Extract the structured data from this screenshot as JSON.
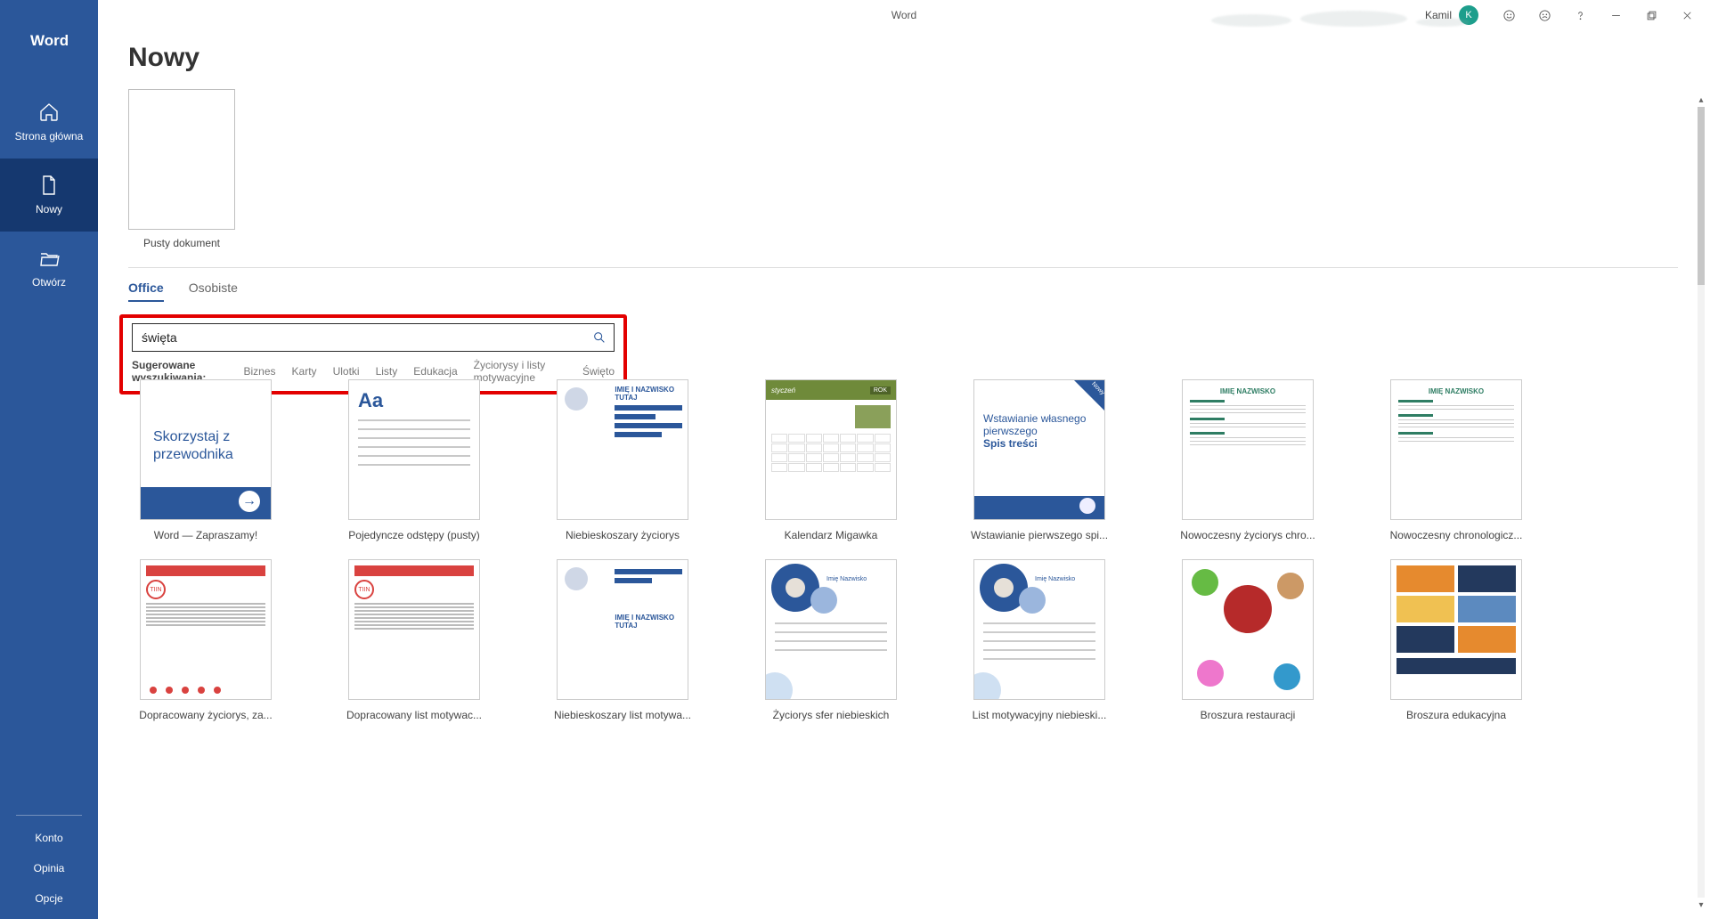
{
  "app_title": "Word",
  "brand": "Word",
  "user": {
    "name": "Kamil",
    "initial": "K"
  },
  "sidebar": {
    "items": [
      {
        "label": "Strona główna"
      },
      {
        "label": "Nowy"
      },
      {
        "label": "Otwórz"
      }
    ],
    "footer": [
      {
        "label": "Konto"
      },
      {
        "label": "Opinia"
      },
      {
        "label": "Opcje"
      }
    ]
  },
  "page_title": "Nowy",
  "blank": {
    "label": "Pusty dokument"
  },
  "tabs": [
    {
      "label": "Office",
      "active": true
    },
    {
      "label": "Osobiste",
      "active": false
    }
  ],
  "search": {
    "value": "święta",
    "suggest_label": "Sugerowane wyszukiwania:",
    "suggestions": [
      "Biznes",
      "Karty",
      "Ulotki",
      "Listy",
      "Edukacja",
      "Życiorysy i listy motywacyjne",
      "Święto"
    ]
  },
  "templates_row1": [
    {
      "label": "Word — Zapraszamy!",
      "kind": "guide",
      "text": "Skorzystaj z przewodnika"
    },
    {
      "label": "Pojedyncze odstępy (pusty)",
      "kind": "space"
    },
    {
      "label": "Niebieskoszary życiorys",
      "kind": "cvblue",
      "name_text": "IMIĘ I NAZWISKO TUTAJ"
    },
    {
      "label": "Kalendarz Migawka",
      "kind": "cal",
      "month": "styczeń",
      "year": "ROK"
    },
    {
      "label": "Wstawianie pierwszego spi...",
      "kind": "toc",
      "text": "Wstawianie własnego pierwszego",
      "strong": "Spis treści",
      "badge": "Nowy"
    },
    {
      "label": "Nowoczesny życiorys chro...",
      "kind": "mod",
      "name_text": "IMIĘ NAZWISKO"
    },
    {
      "label": "Nowoczesny chronologicz...",
      "kind": "mod",
      "name_text": "IMIĘ NAZWISKO"
    }
  ],
  "templates_row2": [
    {
      "label": "Dopracowany życiorys, za...",
      "kind": "red",
      "badge": "TIIN"
    },
    {
      "label": "Dopracowany list motywac...",
      "kind": "red",
      "badge": "TIIN"
    },
    {
      "label": "Niebieskoszary list motywa...",
      "kind": "cvblue",
      "name_text": "IMIĘ I NAZWISKO TUTAJ"
    },
    {
      "label": "Życiorys sfer niebieskich",
      "kind": "circblue",
      "name_text": "Imię Nazwisko"
    },
    {
      "label": "List motywacyjny niebieski...",
      "kind": "circblue",
      "name_text": "Imię Nazwisko"
    },
    {
      "label": "Broszura restauracji",
      "kind": "rest"
    },
    {
      "label": "Broszura edukacyjna",
      "kind": "edu"
    }
  ]
}
